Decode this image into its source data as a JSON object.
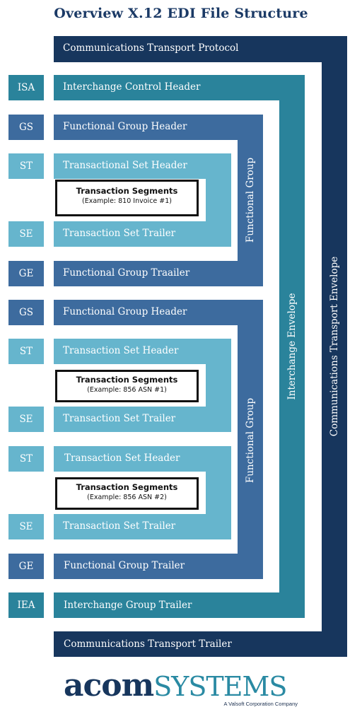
{
  "title": "Overview X.12 EDI File Structure",
  "colors": {
    "transport": "#17365d",
    "interchange": "#2a839b",
    "functional_group": "#3d6b9e",
    "transaction_set": "#66b5cd",
    "title": "#1b3a66"
  },
  "transport": {
    "header": "Communications Transport Protocol",
    "envelope_label": "Communications Transport Envelope",
    "trailer": "Communications Transport Trailer"
  },
  "interchange": {
    "header_tag": "ISA",
    "header": "Interchange Control Header",
    "envelope_label": "Interchange Envelope",
    "trailer_tag": "IEA",
    "trailer": "Interchange Group Trailer"
  },
  "functional_groups": [
    {
      "header_tag": "GS",
      "header": "Functional Group Header",
      "envelope_label": "Functional Group",
      "trailer_tag": "GE",
      "trailer": "Functional Group Traailer",
      "transaction_sets": [
        {
          "header_tag": "ST",
          "header": "Transactional Set Header",
          "segments_title": "Transaction Segments",
          "segments_example": "(Example: 810 Invoice #1)",
          "trailer_tag": "SE",
          "trailer": "Transaction Set Trailer"
        }
      ]
    },
    {
      "header_tag": "GS",
      "header": "Functional Group Header",
      "envelope_label": "Functional Group",
      "trailer_tag": "GE",
      "trailer": "Functional Group Trailer",
      "transaction_sets": [
        {
          "header_tag": "ST",
          "header": "Transaction Set Header",
          "segments_title": "Transaction Segments",
          "segments_example": "(Example: 856 ASN #1)",
          "trailer_tag": "SE",
          "trailer": "Transaction Set Trailer"
        },
        {
          "header_tag": "ST",
          "header": "Transaction Set Header",
          "segments_title": "Transaction Segments",
          "segments_example": "(Example: 856 ASN #2)",
          "trailer_tag": "SE",
          "trailer": "Transaction Set Trailer"
        }
      ]
    }
  ],
  "logo": {
    "part1": "acom",
    "part2": "SYSTEMS",
    "tagline": "A Valsoft Corporation Company"
  }
}
